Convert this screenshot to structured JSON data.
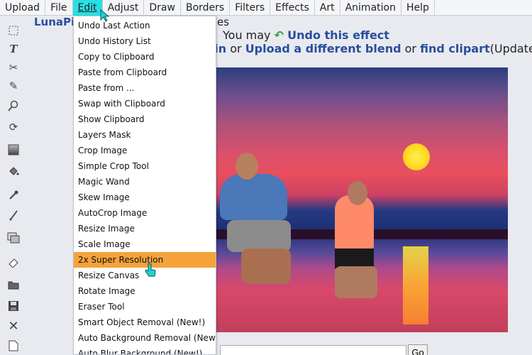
{
  "menubar": {
    "items": [
      {
        "label": "Upload",
        "active": false
      },
      {
        "label": "File",
        "active": false
      },
      {
        "label": "Edit",
        "active": true
      },
      {
        "label": "Adjust",
        "active": false
      },
      {
        "label": "Draw",
        "active": false
      },
      {
        "label": "Borders",
        "active": false
      },
      {
        "label": "Filters",
        "active": false
      },
      {
        "label": "Effects",
        "active": false
      },
      {
        "label": "Art",
        "active": false
      },
      {
        "label": "Animation",
        "active": false
      },
      {
        "label": "Help",
        "active": false
      }
    ]
  },
  "toolbar": {
    "tools": [
      {
        "icon": "selection-icon"
      },
      {
        "icon": "text-icon"
      },
      {
        "icon": "scissors-icon"
      },
      {
        "icon": "pencil-icon"
      },
      {
        "icon": "zoom-icon"
      },
      {
        "icon": "rotate-icon"
      },
      {
        "icon": "gradient-icon"
      },
      {
        "icon": "paint-bucket-icon"
      },
      {
        "icon": "eyedropper-icon"
      },
      {
        "icon": "brush-icon"
      },
      {
        "icon": "layers-icon"
      },
      {
        "icon": "eraser-icon"
      },
      {
        "icon": "open-folder-icon"
      },
      {
        "icon": "save-icon"
      },
      {
        "icon": "close-icon"
      },
      {
        "icon": "new-file-icon"
      }
    ]
  },
  "header": {
    "site_title": "LunaPic",
    "title_suffix": "es"
  },
  "messages": {
    "line1_prefix": "You may",
    "undo_link": "Undo this effect",
    "line2_link1": "gain",
    "line2_or1": "or",
    "line2_link2": "Upload a different blend",
    "line2_or2": "or",
    "line2_link3": "find clipart",
    "line2_suffix": "(Updated!)."
  },
  "edit_menu": {
    "items": [
      {
        "label": "Undo Last Action"
      },
      {
        "label": "Undo History List"
      },
      {
        "label": "Copy to Clipboard"
      },
      {
        "label": "Paste from Clipboard"
      },
      {
        "label": "Paste from ..."
      },
      {
        "label": "Swap with Clipboard"
      },
      {
        "label": "Show Clipboard"
      },
      {
        "label": "Layers Mask"
      },
      {
        "label": "Crop Image"
      },
      {
        "label": "Simple Crop Tool"
      },
      {
        "label": "Magic Wand"
      },
      {
        "label": "Skew Image"
      },
      {
        "label": "AutoCrop Image"
      },
      {
        "label": "Resize Image"
      },
      {
        "label": "Scale Image"
      },
      {
        "label": "2x Super Resolution"
      },
      {
        "label": "Resize Canvas"
      },
      {
        "label": "Rotate Image"
      },
      {
        "label": "Eraser Tool"
      },
      {
        "label": "Smart Object Removal (New!)"
      },
      {
        "label": "Auto Background Removal (New!)"
      },
      {
        "label": "Auto Blur Background (New!)"
      }
    ],
    "highlighted_label": "2x Super Resolution"
  },
  "bottom": {
    "go_label": "Go"
  },
  "colors": {
    "active_menu": "#27e0e6",
    "highlight": "#f5a33a",
    "link": "#2a4d9b"
  }
}
